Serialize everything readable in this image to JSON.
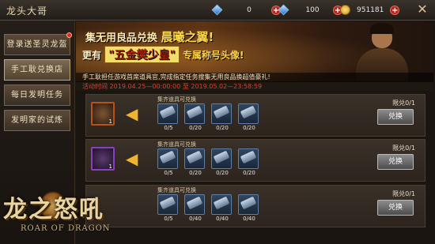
{
  "header": {
    "title": "龙头大哥",
    "resources": [
      {
        "icon": "blue-diamond-icon",
        "value": "0"
      },
      {
        "icon": "blue-diamond-stack-icon",
        "value": "100"
      },
      {
        "icon": "gold-coin-icon",
        "value": "951181"
      }
    ],
    "close_symbol": "✕"
  },
  "sidebar": {
    "items": [
      {
        "label": "登录送圣灵龙盔",
        "active": false,
        "badge": true
      },
      {
        "label": "手工耿兑换店",
        "active": true,
        "badge": false
      },
      {
        "label": "每日发明任务",
        "active": false,
        "badge": false
      },
      {
        "label": "发明家的试炼",
        "active": false,
        "badge": false
      }
    ]
  },
  "logo": {
    "main": "龙之怒吼",
    "sub": "ROAR OF DRAGON"
  },
  "banner": {
    "line1_prefix": "集无用良品兑换",
    "line1_highlight": "晨曦之翼!",
    "line2_prefix": "更有",
    "line2_gold": "\"五金樊少皇\"",
    "line2_suffix": "专属称号头像!",
    "description": "手工耿担任游戏首席道具官,完成指定任务搜集无用良品换超值豪礼!"
  },
  "time": {
    "label": "活动时间",
    "start": "2019.04.25—00:00:00",
    "to": "至",
    "end": "2019.05.02—23:58:59"
  },
  "rows": [
    {
      "reward_count": "1",
      "reward_style": "orange",
      "requirement_label": "集齐道具可兑换",
      "items": [
        "0/5",
        "0/20",
        "0/20",
        "0/20"
      ],
      "limit": "限兑0/1",
      "button": "兑换"
    },
    {
      "reward_count": "1",
      "reward_style": "purple",
      "requirement_label": "集齐道具可兑换",
      "items": [
        "0/5",
        "0/20",
        "0/20",
        "0/20"
      ],
      "limit": "限兑0/1",
      "button": "兑换"
    },
    {
      "reward_count": "",
      "reward_style": "orange",
      "requirement_label": "集齐道具可兑换",
      "items": [
        "0/5",
        "0/40",
        "0/40",
        "0/40"
      ],
      "limit": "限兑0/1",
      "button": "兑换"
    }
  ]
}
